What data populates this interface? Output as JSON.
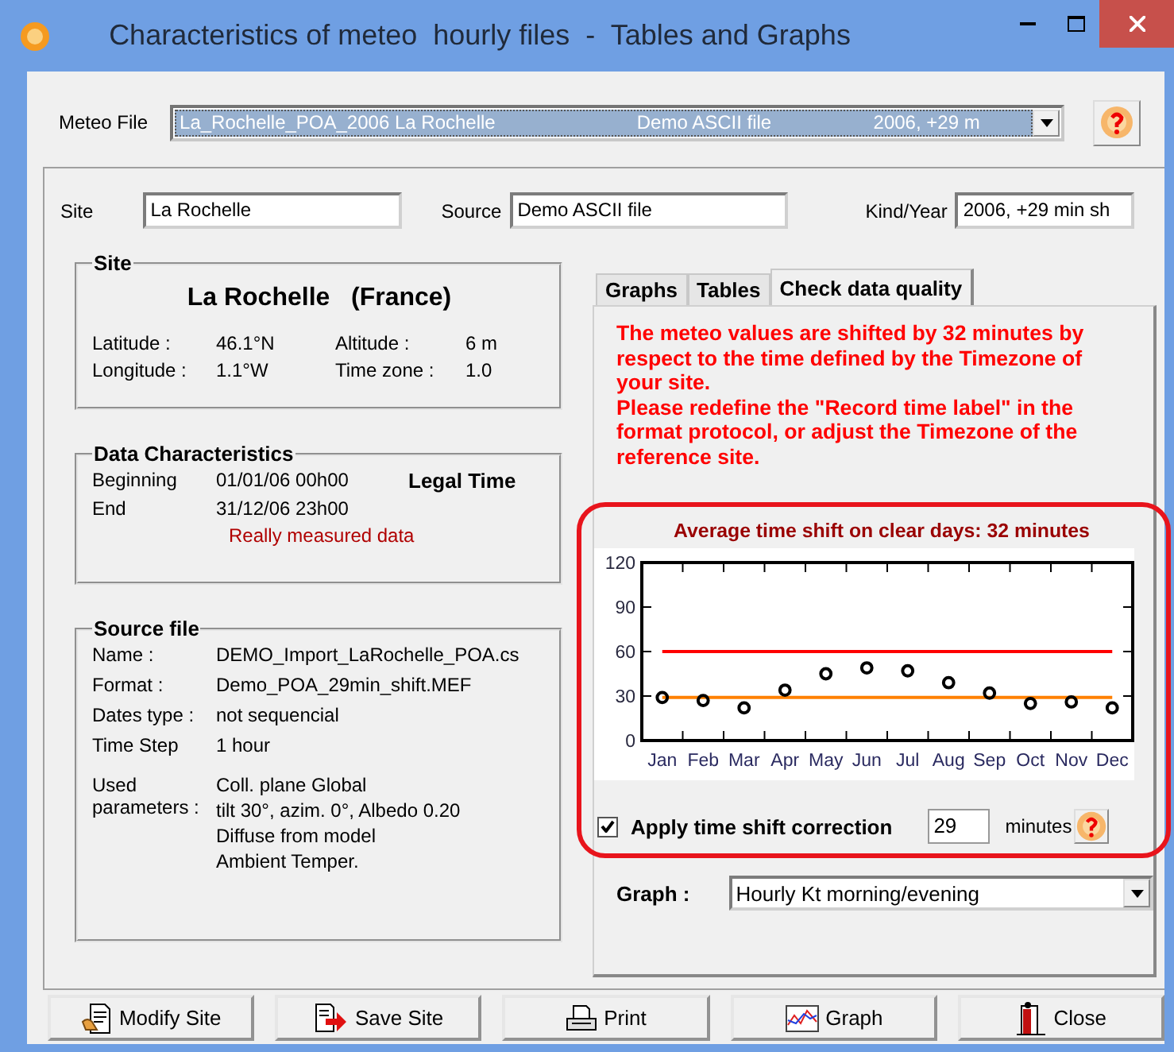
{
  "window": {
    "title": "Characteristics of meteo  hourly files  -  Tables and Graphs"
  },
  "meteo_file": {
    "label": "Meteo File",
    "columns": [
      "La_Rochelle_POA_2006 La Rochelle",
      "Demo ASCII file",
      "2006, +29 m"
    ],
    "highlighted": true
  },
  "header_fields": [
    {
      "label": "Site",
      "value": "La Rochelle"
    },
    {
      "label": "Source",
      "value": "Demo ASCII file"
    },
    {
      "label": "Kind/Year",
      "value": "2006, +29 min sh"
    }
  ],
  "site_group": {
    "title": "Site",
    "name": "La Rochelle",
    "country": "(France)",
    "rows": [
      {
        "label": "Latitude :",
        "value": "46.1°N",
        "label2": "Altitude :",
        "value2": "6 m"
      },
      {
        "label": "Longitude :",
        "value": "1.1°W",
        "label2": "Time zone :",
        "value2": "1.0"
      }
    ]
  },
  "data_group": {
    "title": "Data Characteristics",
    "rows": [
      {
        "label": "Beginning",
        "value": "01/01/06 00h00"
      },
      {
        "label": "End",
        "value": "31/12/06 23h00"
      }
    ],
    "time_kind": "Legal Time",
    "note": "Really measured data"
  },
  "source_group": {
    "title": "Source file",
    "rows": [
      {
        "label": "Name :",
        "lines": [
          "DEMO_Import_LaRochelle_POA.cs"
        ]
      },
      {
        "label": "Format :",
        "lines": [
          "Demo_POA_29min_shift.MEF"
        ]
      },
      {
        "label": "Dates type :",
        "lines": [
          "not sequencial"
        ]
      },
      {
        "label": "Time Step",
        "lines": [
          "1 hour"
        ]
      },
      {
        "label": "Used parameters :",
        "lines": [
          "Coll. plane Global",
          "tilt 30°, azim. 0°, Albedo 0.20",
          "Diffuse from model",
          "Ambient Temper."
        ]
      }
    ]
  },
  "tabs": [
    {
      "label": "Graphs",
      "selected": false
    },
    {
      "label": "Tables",
      "selected": false
    },
    {
      "label": "Check data quality",
      "selected": true
    }
  ],
  "warning": [
    "The meteo values are shifted by 32 minutes by respect to the time defined by the Timezone of your site.",
    "Please redefine the \"Record time label\" in the format protocol, or adjust the Timezone of the reference site."
  ],
  "shift_panel": {
    "chart_data": {
      "type": "scatter",
      "title": "Average time shift on clear days: 32 minutes",
      "ylim": [
        0,
        120
      ],
      "yticks": [
        0,
        30,
        60,
        90,
        120
      ],
      "categories": [
        "Jan",
        "Feb",
        "Mar",
        "Apr",
        "May",
        "Jun",
        "Jul",
        "Aug",
        "Sep",
        "Oct",
        "Nov",
        "Dec"
      ],
      "series": [
        {
          "type": "scatter",
          "color": "#000000",
          "values": [
            29,
            27,
            22,
            34,
            45,
            49,
            47,
            39,
            32,
            25,
            26,
            22
          ]
        },
        {
          "type": "line",
          "color": "#ff0000",
          "values": [
            60,
            60,
            60,
            60,
            60,
            60,
            60,
            60,
            60,
            60,
            60,
            60
          ]
        },
        {
          "type": "line",
          "color": "#ff8000",
          "values": [
            29,
            29,
            29,
            29,
            29,
            29,
            29,
            29,
            29,
            29,
            29,
            29
          ]
        }
      ]
    },
    "apply": {
      "label": "Apply time shift correction",
      "checked": true
    },
    "shift_value": "29",
    "unit": "minutes"
  },
  "graph_select": {
    "label": "Graph :",
    "value": "Hourly Kt morning/evening"
  },
  "buttons": [
    {
      "label": "Modify Site",
      "kind": "modify"
    },
    {
      "label": "Save Site",
      "kind": "save"
    },
    {
      "label": "Print",
      "kind": "print"
    },
    {
      "label": "Graph",
      "kind": "graph"
    },
    {
      "label": "Close",
      "kind": "close"
    }
  ]
}
